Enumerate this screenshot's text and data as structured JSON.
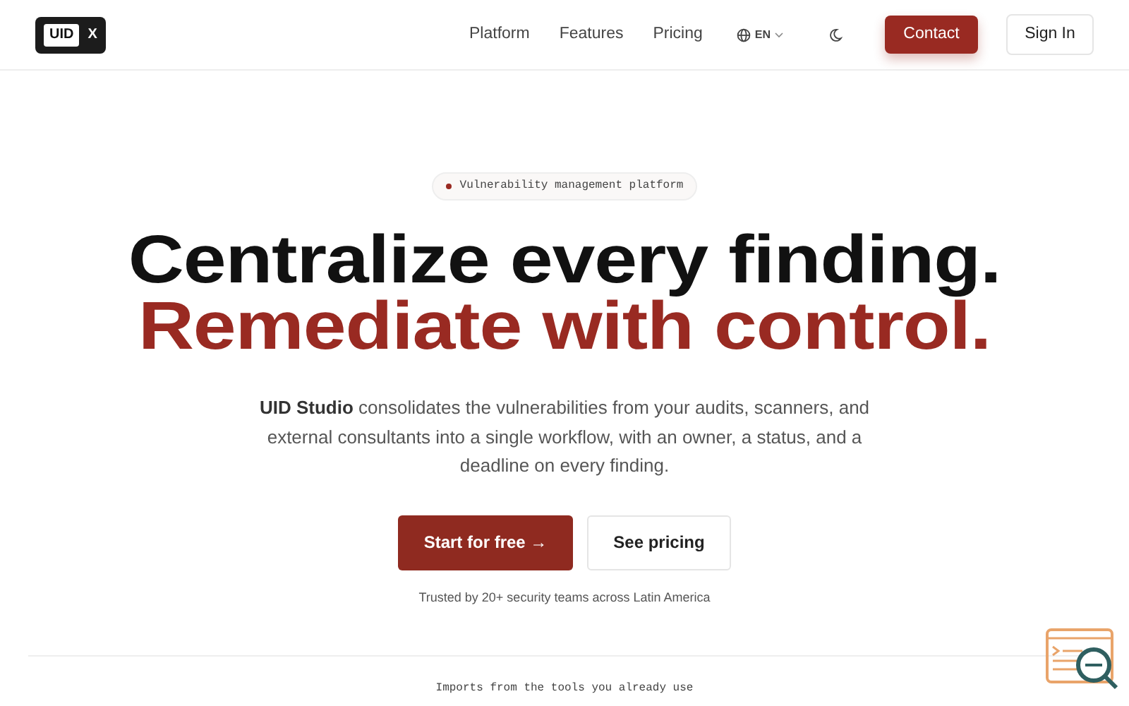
{
  "logo": {
    "main": "UID",
    "mark": "X"
  },
  "nav": {
    "links": [
      "Platform",
      "Features",
      "Pricing"
    ],
    "language": "EN",
    "contact": "Contact",
    "sign_in": "Sign In"
  },
  "hero": {
    "badge": "Vulnerability management platform",
    "headline": [
      {
        "text": "Centralize every finding.",
        "kind": "plain"
      },
      {
        "text": "Remediate with control.",
        "kind": "accent"
      }
    ],
    "description": "**UID Studio** consolidates the vulnerabilities from your audits, scanners, and external consultants into a single workflow, with an owner, a status, and a deadline on every finding.",
    "primary": "Start for free",
    "primary_arrow": "→",
    "secondary": "See pricing",
    "trust": "Trusted by 20+ security teams across Latin America"
  },
  "imports": {
    "caption": "Imports from the tools you already use"
  }
}
